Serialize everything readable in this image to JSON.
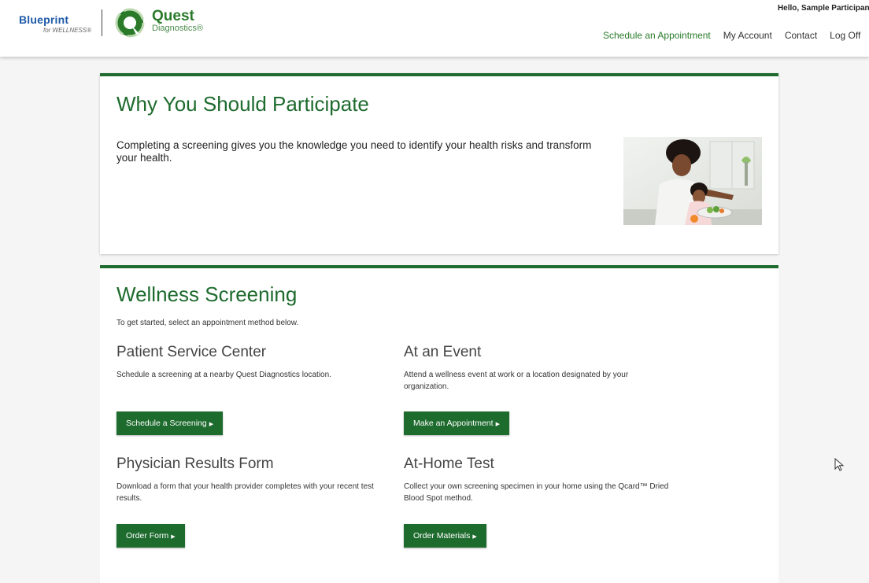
{
  "header": {
    "blueprint": {
      "main": "Blueprint",
      "sub": "for WELLNESS®"
    },
    "quest": {
      "name": "Quest",
      "sub": "Diagnostics®"
    },
    "greeting": "Hello, Sample Participant",
    "nav": [
      {
        "label": "Schedule an Appointment"
      },
      {
        "label": "My Account"
      },
      {
        "label": "Contact"
      },
      {
        "label": "Log Off"
      }
    ]
  },
  "why": {
    "title": "Why You Should Participate",
    "body": "Completing a screening gives you the knowledge you need to identify your health risks and transform your health."
  },
  "screening": {
    "title": "Wellness Screening",
    "lead": "To get started, select an appointment method below.",
    "options": [
      {
        "title": "Patient Service Center",
        "desc": "Schedule a screening at a nearby Quest Diagnostics location.",
        "button": "Schedule a Screening"
      },
      {
        "title": "At an Event",
        "desc": "Attend a wellness event at work or a location designated by your organization.",
        "button": "Make an Appointment"
      },
      {
        "title": "Physician Results Form",
        "desc": "Download a form that your health provider completes with your recent test results.",
        "button": "Order Form"
      },
      {
        "title": "At-Home Test",
        "desc": "Collect your own screening specimen in your home using the Qcard™ Dried Blood Spot method.",
        "button": "Order Materials"
      }
    ]
  },
  "colors": {
    "accent": "#1e6b2e",
    "brand_blue": "#1e5aa8"
  }
}
